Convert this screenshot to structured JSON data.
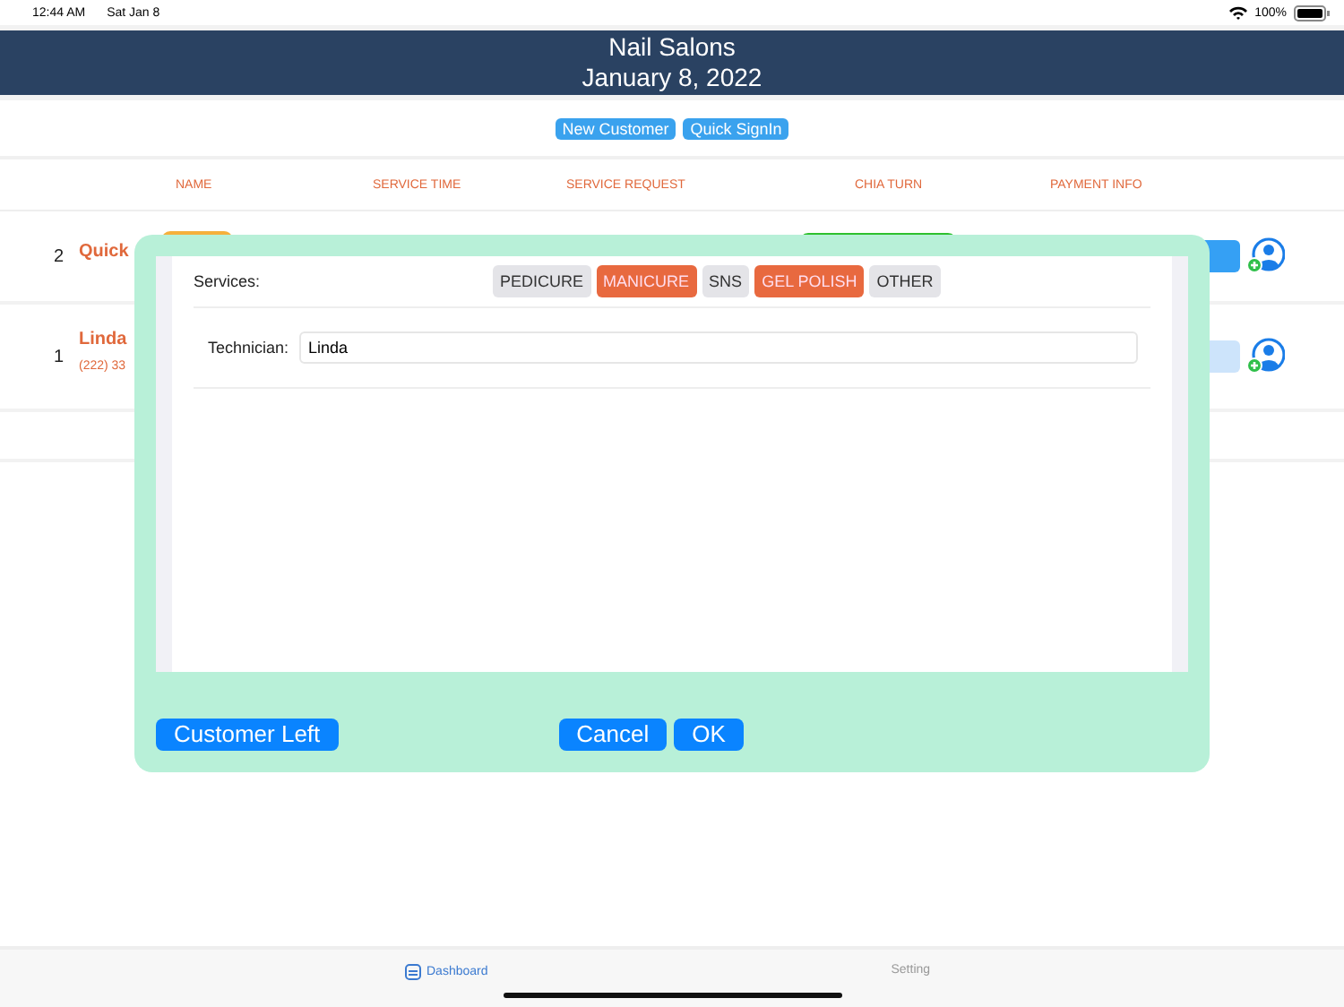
{
  "status_bar": {
    "time": "12:44 AM",
    "date": "Sat Jan 8",
    "battery": "100%"
  },
  "header": {
    "title": "Nail Salons",
    "date": "January 8, 2022"
  },
  "actions": [
    "New Customer",
    "Quick SignIn"
  ],
  "table": {
    "columns": [
      "NAME",
      "SERVICE TIME",
      "SERVICE REQUEST",
      "CHIA TURN",
      "PAYMENT INFO"
    ],
    "rows": [
      {
        "number": "2",
        "name": "Quick",
        "badge": true,
        "paid": true
      },
      {
        "number": "1",
        "name": "Linda",
        "phone": "(222) 33",
        "badge": false,
        "paid": false
      }
    ]
  },
  "dialog": {
    "services_label": "Services:",
    "services": [
      {
        "label": "PEDICURE",
        "selected": false
      },
      {
        "label": "MANICURE",
        "selected": true
      },
      {
        "label": "SNS",
        "selected": false
      },
      {
        "label": "GEL POLISH",
        "selected": true
      },
      {
        "label": "OTHER",
        "selected": false
      }
    ],
    "technician_label": "Technician:",
    "technician": "Linda",
    "left_button": "Customer Left",
    "buttons": [
      "Cancel",
      "OK"
    ]
  },
  "tabs": [
    {
      "label": "Dashboard",
      "selected": true
    },
    {
      "label": "Setting",
      "selected": false
    }
  ]
}
